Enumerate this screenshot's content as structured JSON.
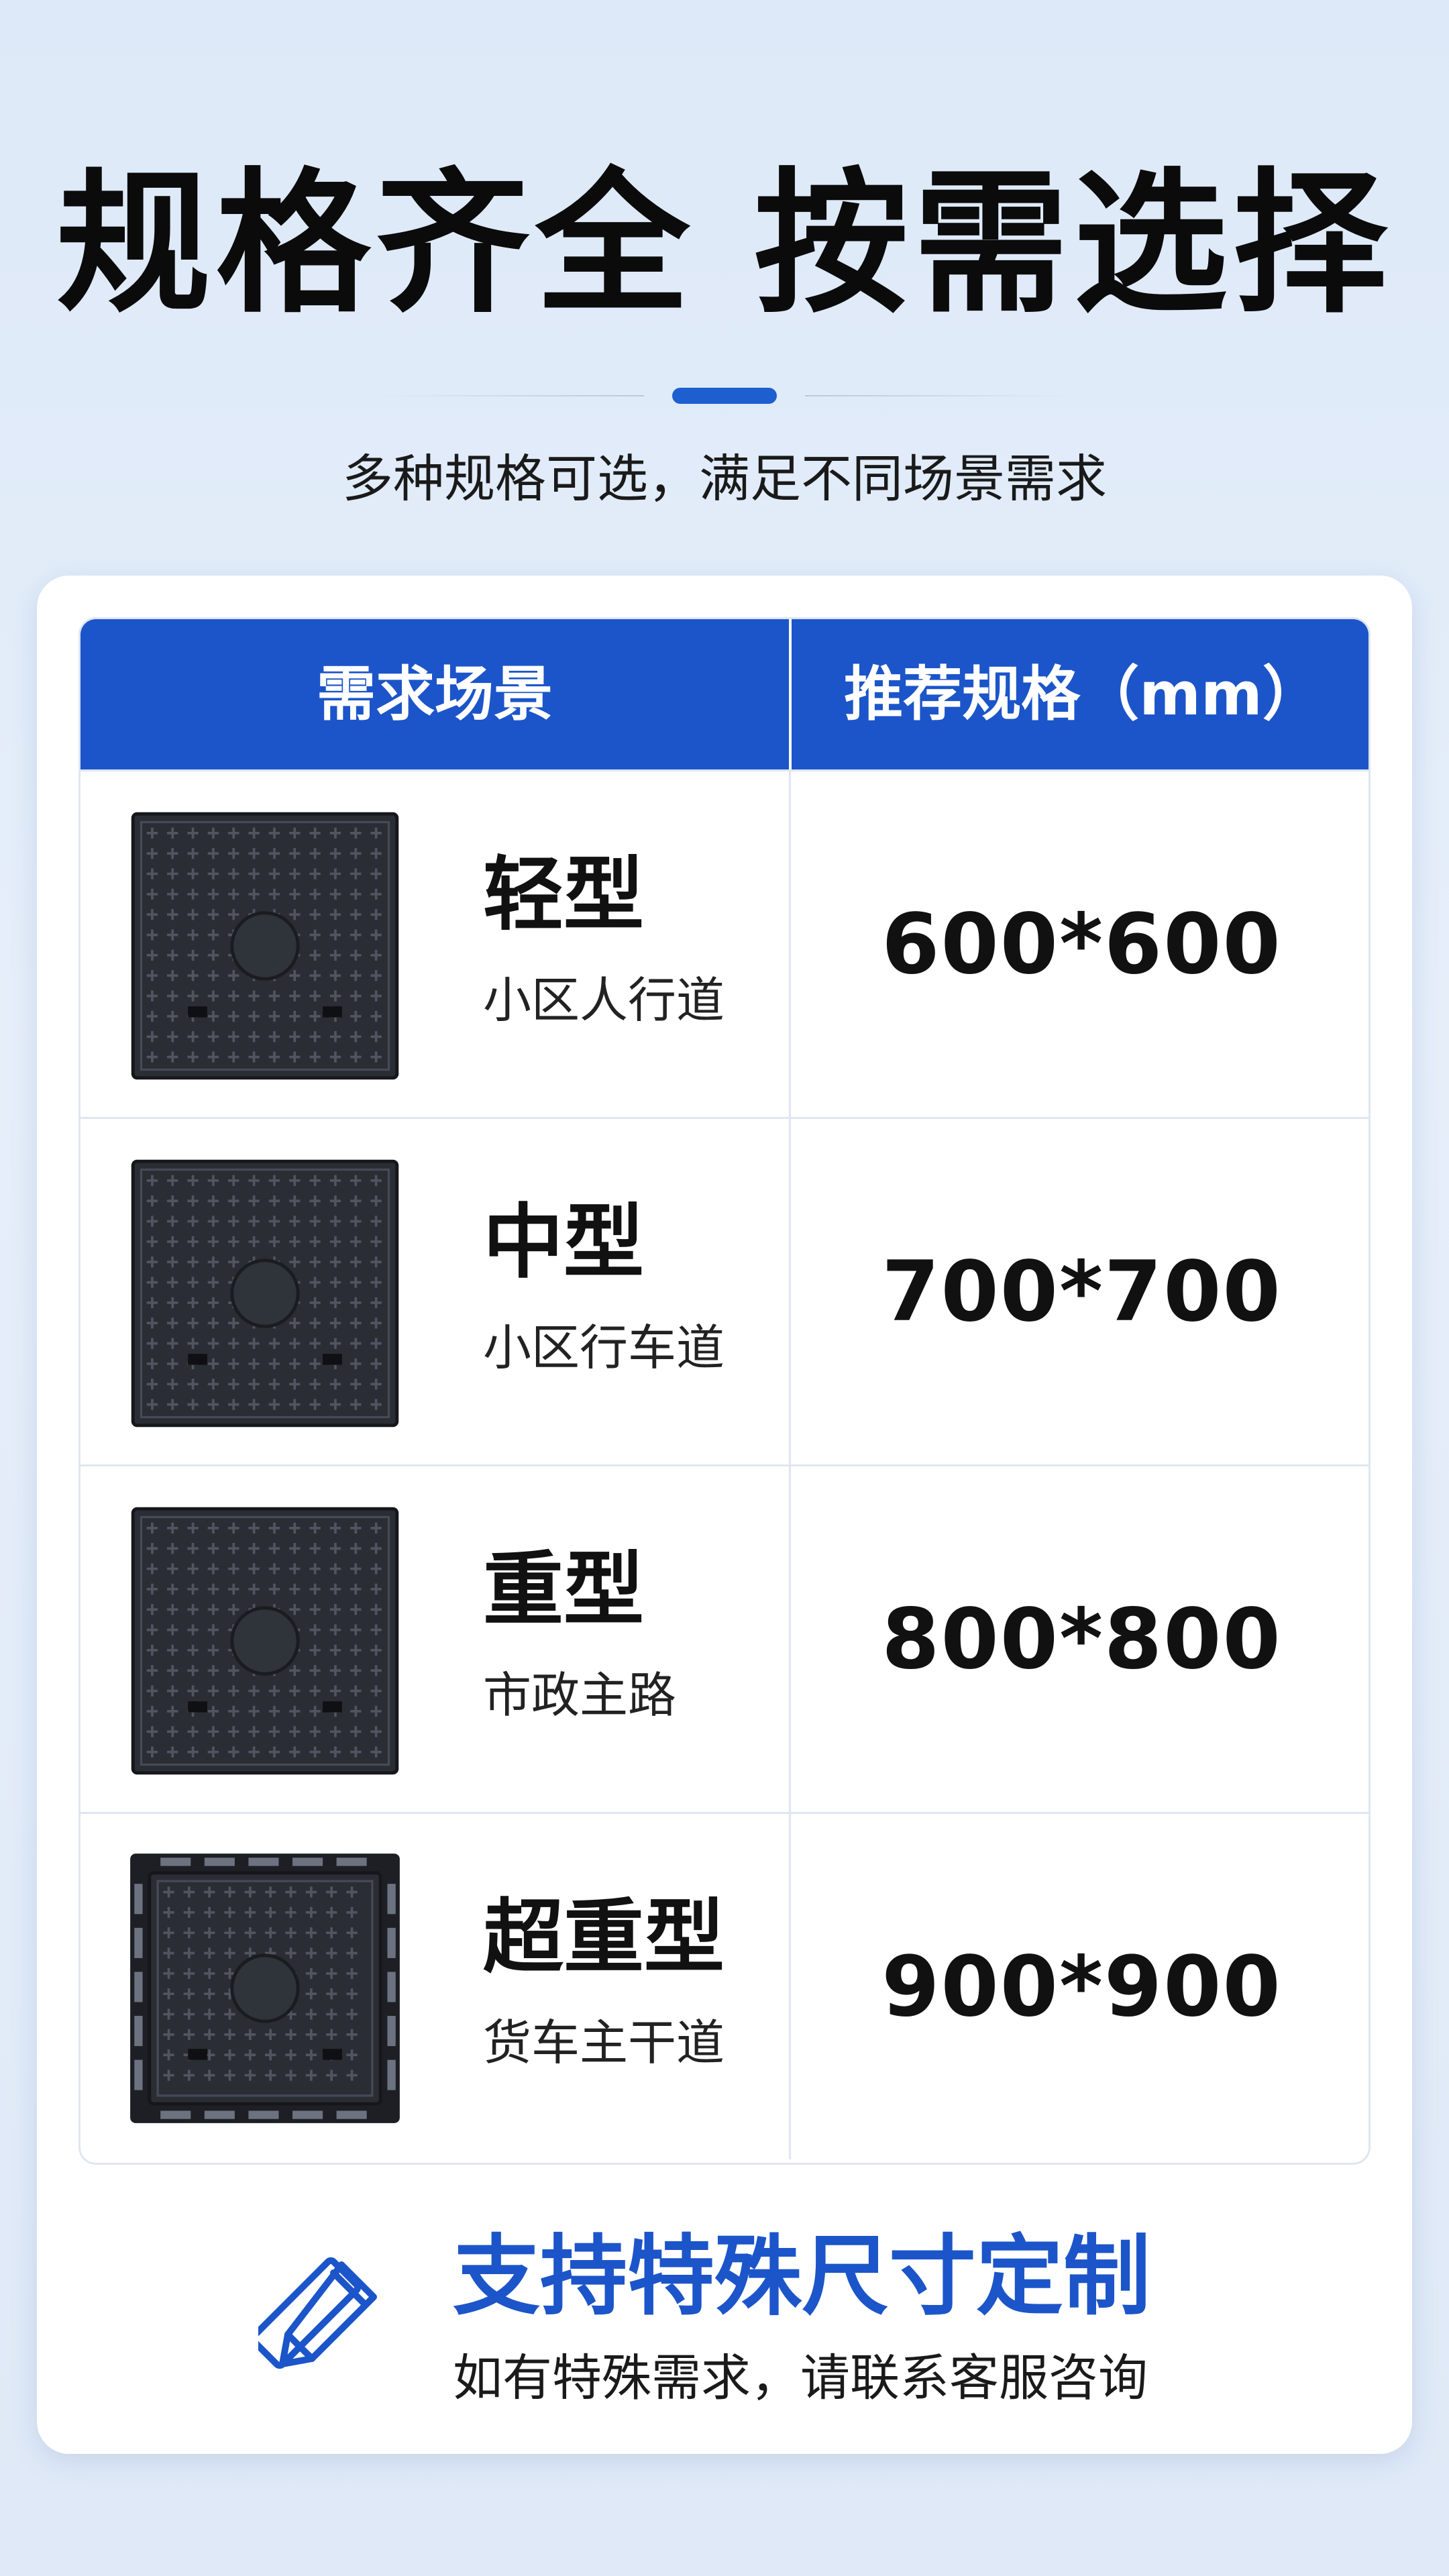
{
  "header": {
    "title": "规格齐全 按需选择",
    "subtitle": "多种规格可选，满足不同场景需求"
  },
  "table": {
    "columns": [
      "需求场景",
      "推荐规格（mm）"
    ],
    "rows": [
      {
        "name": "轻型",
        "desc": "小区人行道",
        "spec": "600*600"
      },
      {
        "name": "中型",
        "desc": "小区行车道",
        "spec": "700*700"
      },
      {
        "name": "重型",
        "desc": "市政主路",
        "spec": "800*800"
      },
      {
        "name": "超重型",
        "desc": "货车主干道",
        "spec": "900*900"
      }
    ]
  },
  "custom": {
    "icon": "ruler-pencil-icon",
    "title": "支持特殊尺寸定制",
    "subtitle": "如有特殊需求，请联系客服咨询"
  },
  "colors": {
    "accent": "#1c55c9",
    "background": "#dde9f8",
    "cover": "#2a2d33"
  }
}
